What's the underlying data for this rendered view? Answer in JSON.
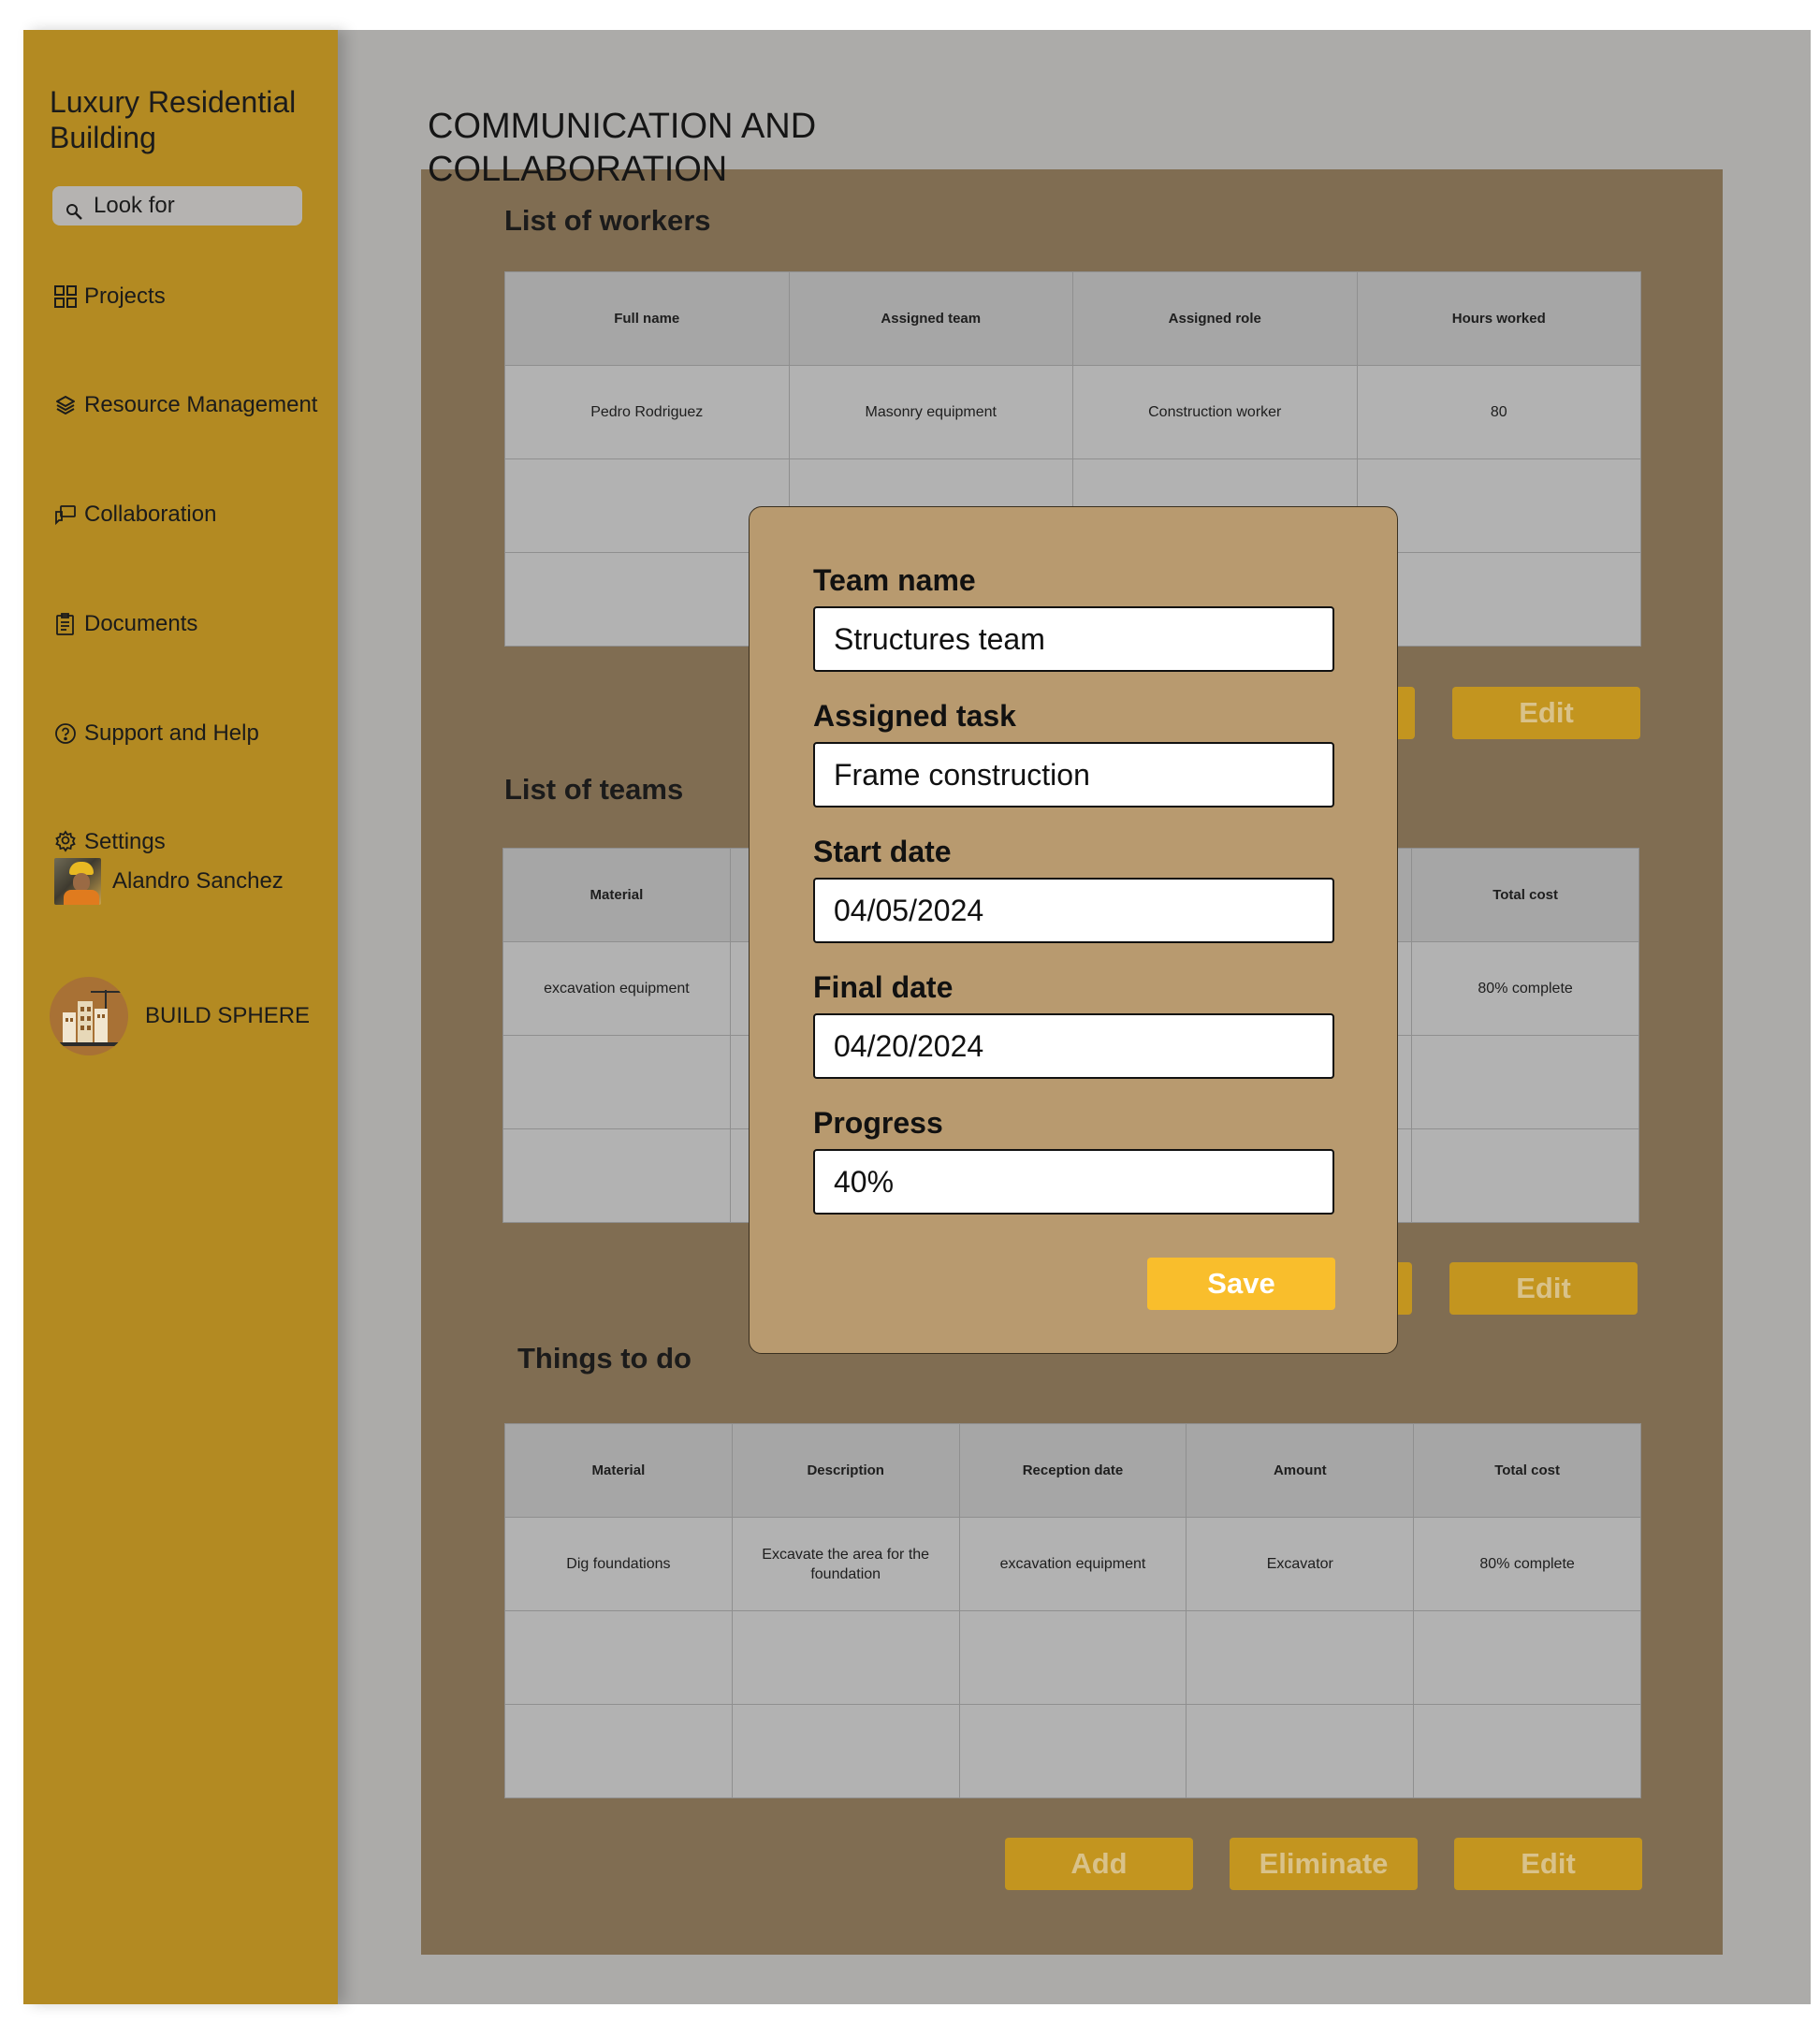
{
  "sidebar": {
    "project_title": "Luxury Residential Building",
    "search_placeholder": "Look for",
    "items": [
      {
        "label": "Projects",
        "icon": "grid-icon"
      },
      {
        "label": "Resource Management",
        "icon": "layers-icon"
      },
      {
        "label": "Collaboration",
        "icon": "chat-icon"
      },
      {
        "label": "Documents",
        "icon": "document-icon"
      },
      {
        "label": "Support and Help",
        "icon": "help-icon"
      },
      {
        "label": "Settings",
        "icon": "gear-icon"
      }
    ],
    "user_name": "Alandro Sanchez",
    "brand_name": "BUILD SPHERE"
  },
  "page": {
    "title": "COMMUNICATION AND COLLABORATION"
  },
  "workers": {
    "title": "List of workers",
    "headers": [
      "Full name",
      "Assigned team",
      "Assigned role",
      "Hours worked"
    ],
    "rows": [
      [
        "Pedro Rodriguez",
        "Masonry equipment",
        "Construction worker",
        "80"
      ],
      [
        "",
        "",
        "",
        ""
      ],
      [
        "",
        "",
        "",
        ""
      ]
    ],
    "edit_label": "Edit"
  },
  "teams": {
    "title": "List of teams",
    "headers": [
      "Material",
      "",
      "",
      "",
      "Total cost"
    ],
    "rows": [
      [
        "excavation equipment",
        "",
        "",
        "",
        "80% complete"
      ],
      [
        "",
        "",
        "",
        "",
        ""
      ],
      [
        "",
        "",
        "",
        "",
        ""
      ]
    ],
    "edit_label": "Edit"
  },
  "todo": {
    "title": "Things to do",
    "headers": [
      "Material",
      "Description",
      "Reception date",
      "Amount",
      "Total cost"
    ],
    "rows": [
      [
        "Dig foundations",
        "Excavate the area for the foundation",
        "excavation equipment",
        "Excavator",
        "80% complete"
      ],
      [
        "",
        "",
        "",
        "",
        ""
      ],
      [
        "",
        "",
        "",
        "",
        ""
      ]
    ],
    "add_label": "Add",
    "eliminate_label": "Eliminate",
    "edit_label": "Edit"
  },
  "modal": {
    "team_name_label": "Team name",
    "team_name_value": "Structures team",
    "assigned_task_label": "Assigned task",
    "assigned_task_value": "Frame construction",
    "start_date_label": "Start date",
    "start_date_value": "04/05/2024",
    "final_date_label": "Final date",
    "final_date_value": "04/20/2024",
    "progress_label": "Progress",
    "progress_value": "40%",
    "save_label": "Save"
  },
  "colors": {
    "sidebar": "#b38a22",
    "panel": "#806d52",
    "modal": "#b89a6f",
    "save_button": "#f9be2c",
    "dim_button": "#c3951f"
  }
}
